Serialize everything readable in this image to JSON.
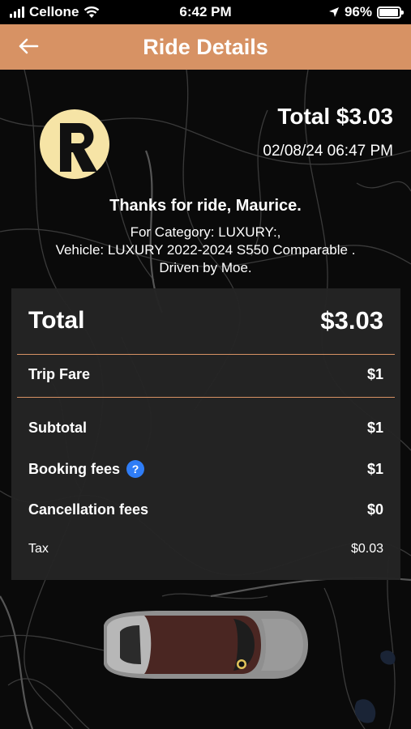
{
  "status": {
    "carrier": "Cellone",
    "time": "6:42 PM",
    "battery": "96%",
    "battery_level": 0.96
  },
  "header": {
    "title": "Ride Details",
    "back_icon": "arrow-left-icon"
  },
  "ride": {
    "total_label": "Total $3.03",
    "datetime": "02/08/24 06:47 PM",
    "thanks": "Thanks for ride, Maurice.",
    "category_line": "For Category: LUXURY:,",
    "vehicle_line": "Vehicle: LUXURY 2022-2024 S550 Comparable .",
    "driver_line": "Driven by Moe."
  },
  "fare": {
    "total_label": "Total",
    "total_value": "$3.03",
    "trip_fare_label": "Trip Fare",
    "trip_fare_value": "$1",
    "subtotal_label": "Subtotal",
    "subtotal_value": "$1",
    "booking_label": "Booking fees",
    "booking_value": "$1",
    "help_glyph": "?",
    "cancellation_label": "Cancellation fees",
    "cancellation_value": "$0",
    "tax_label": "Tax",
    "tax_value": "$0.03"
  },
  "colors": {
    "accent": "#d79264",
    "card_bg": "#242424",
    "help": "#2f7df6"
  }
}
